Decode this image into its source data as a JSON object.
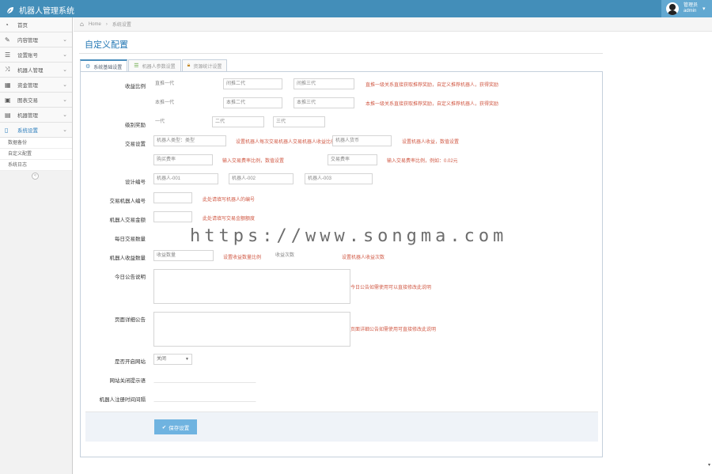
{
  "app": {
    "title": "机器人管理系统"
  },
  "user": {
    "name": "管理员",
    "role": "admin"
  },
  "sidebar": {
    "items": [
      {
        "label": "首页",
        "icon": "dashboard-icon"
      },
      {
        "label": "内容管理",
        "icon": "edit-icon"
      },
      {
        "label": "设置账号",
        "icon": "list-icon"
      },
      {
        "label": "机器人管理",
        "icon": "random-icon"
      },
      {
        "label": "资金管理",
        "icon": "calendar-icon"
      },
      {
        "label": "图表交易",
        "icon": "picture-icon"
      },
      {
        "label": "机器管理",
        "icon": "book-icon"
      },
      {
        "label": "系统设置",
        "icon": "file-icon"
      }
    ],
    "sub_items": [
      "数据备份",
      "自定义配置",
      "系统日志"
    ]
  },
  "breadcrumb": {
    "home": "Home",
    "current": "系统设置"
  },
  "page": {
    "title": "自定义配置"
  },
  "tabs": [
    {
      "label": "系统基础设置",
      "icon": "gear-icon"
    },
    {
      "label": "机器人参数设置",
      "icon": "list-icon"
    },
    {
      "label": "资源统计设置",
      "icon": "lock-icon"
    }
  ],
  "form": {
    "reward_label": "收益比例",
    "reward_row1": [
      "直推一代",
      "间推二代",
      "间推三代"
    ],
    "reward_row1_hint": "直推一级关系直接获取推荐奖励，自定义推荐机器人，获得奖励",
    "reward_row2": [
      "本推一代",
      "本推二代",
      "本推三代"
    ],
    "reward_row2_hint": "本推一级关系直接获取推荐奖励，自定义推荐机器人，获得奖励",
    "level_label": "级别奖励",
    "level_values": [
      "一代",
      "二代",
      "三代"
    ],
    "trade_label": "交易设置",
    "trade_row1": [
      "机器人类型：类型",
      "机器人货币"
    ],
    "trade_row1_hint1": "设置机器人每次交易机器人交易机器人收益比例",
    "trade_row1_hint2": "设置机器人收益，数值设置",
    "trade_row2": [
      "购买费率",
      "交易费率"
    ],
    "trade_row2_hint1": "输入交易费率比例，数值设置",
    "trade_row2_hint2": "输入交易费率比例，例如：0.02元",
    "machine_label": "设计编号",
    "machine_values": [
      "机器人-001",
      "机器人-002",
      "机器人-003"
    ],
    "robot_no_label": "交易机器人编号",
    "robot_no_hint": "此处请填写机器人的编号",
    "limit_label": "机器人交易金额",
    "limit_hint": "此处请填写交易金额额度",
    "daily_label": "每日交易数量",
    "bonus_label": "机器人收益数量",
    "bonus_values": [
      "收益数量",
      "收益次数"
    ],
    "bonus_hint1": "设置收益数量比例",
    "bonus_hint2": "设置机器人收益次数",
    "notice_label": "今日公告说明",
    "notice_hint": "今日公告如需使用可以直接修改此说明",
    "page_notice_label": "页面详细公告",
    "page_notice_hint": "页面详细公告如需使用可直接修改此说明",
    "open_label": "是否开启网站",
    "open_value": "关闭",
    "site_label": "网站关闭提示语",
    "reg_label": "机器人注册时间间隔",
    "submit": "保存设置"
  },
  "watermark": "https://www.songma.com"
}
